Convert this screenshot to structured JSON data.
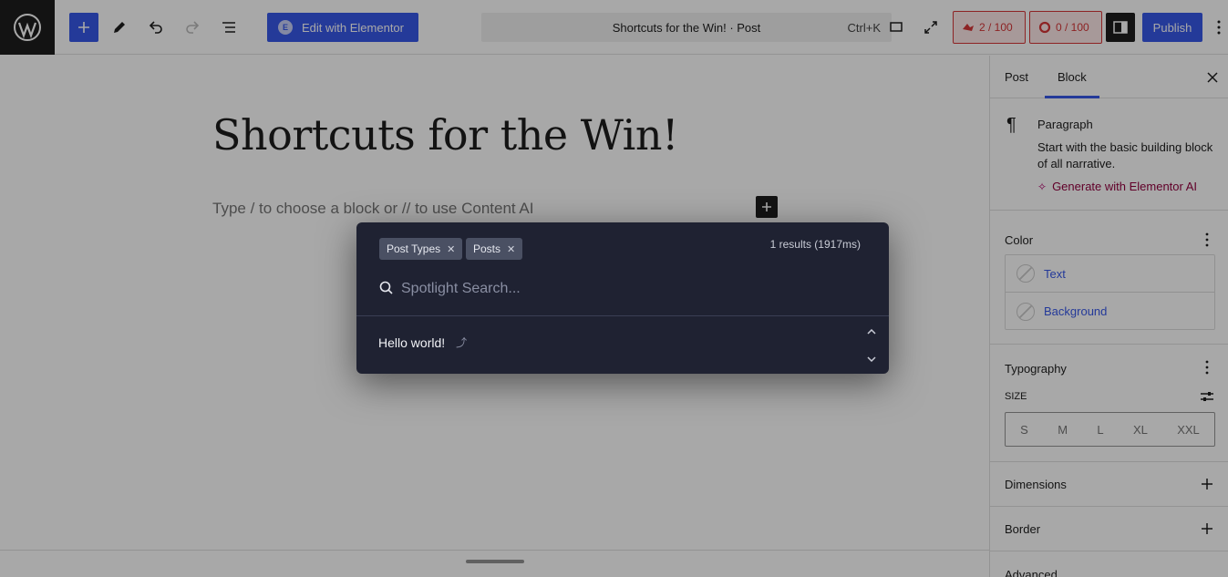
{
  "topbar": {
    "elementor_label": "Edit with Elementor",
    "command_title": "Shortcuts for the Win! · Post",
    "command_shortcut": "Ctrl+K",
    "counter_1": "2 / 100",
    "counter_2": "0 / 100",
    "publish_label": "Publish"
  },
  "editor": {
    "post_title": "Shortcuts for the Win!",
    "placeholder": "Type / to choose a block or // to use Content AI"
  },
  "sidebar": {
    "tabs": [
      "Post",
      "Block"
    ],
    "block_name": "Paragraph",
    "block_description": "Start with the basic building block of all narrative.",
    "generate_ai": "Generate with Elementor AI",
    "color": {
      "title": "Color",
      "items": [
        "Text",
        "Background"
      ]
    },
    "typography": {
      "title": "Typography",
      "size_label": "SIZE",
      "sizes": [
        "S",
        "M",
        "L",
        "XL",
        "XXL"
      ]
    },
    "dimensions_title": "Dimensions",
    "border_title": "Border",
    "advanced_title": "Advanced"
  },
  "spotlight": {
    "filters": [
      "Post Types",
      "Posts"
    ],
    "results_count": "1 results (1917ms)",
    "placeholder": "Spotlight Search...",
    "results": [
      "Hello world!"
    ]
  },
  "colors": {
    "accent": "#3858e9",
    "modal_bg": "#1f2232",
    "counter_red": "#d63638",
    "ai_magenta": "#93003f"
  }
}
